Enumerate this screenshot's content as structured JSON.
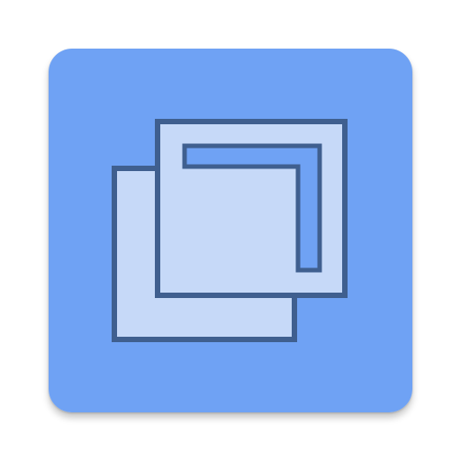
{
  "app_icon": {
    "icon": "overlapping-windows-icon",
    "colors": {
      "tile_background": "#6fa2f4",
      "window_fill": "#c6d9f8",
      "window_outline": "#3f5f8f"
    }
  }
}
